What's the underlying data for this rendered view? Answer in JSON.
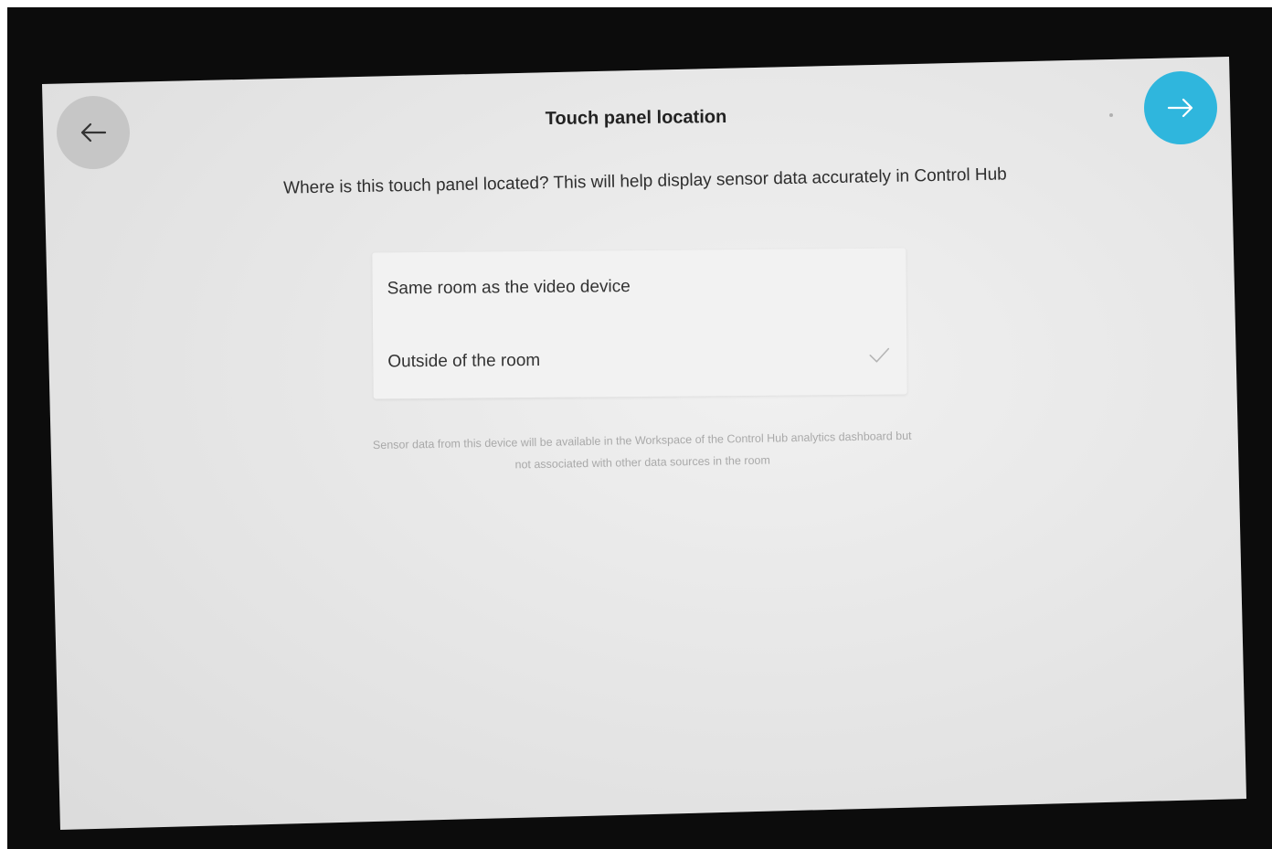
{
  "header": {
    "title": "Touch panel location",
    "back_icon": "arrow-left-icon",
    "next_icon": "arrow-right-icon"
  },
  "question": "Where is this touch panel located? This will help display sensor data accurately in Control Hub",
  "options": [
    {
      "label": "Same room as the video device",
      "selected": false
    },
    {
      "label": "Outside of the room",
      "selected": true
    }
  ],
  "footnote": "Sensor data from this device will be available in the Workspace of the Control Hub analytics dashboard but not associated with other data sources in the room",
  "colors": {
    "accent": "#2fb6dd",
    "back_button": "#c6c6c6",
    "screen_background": "#e9e9e9"
  }
}
